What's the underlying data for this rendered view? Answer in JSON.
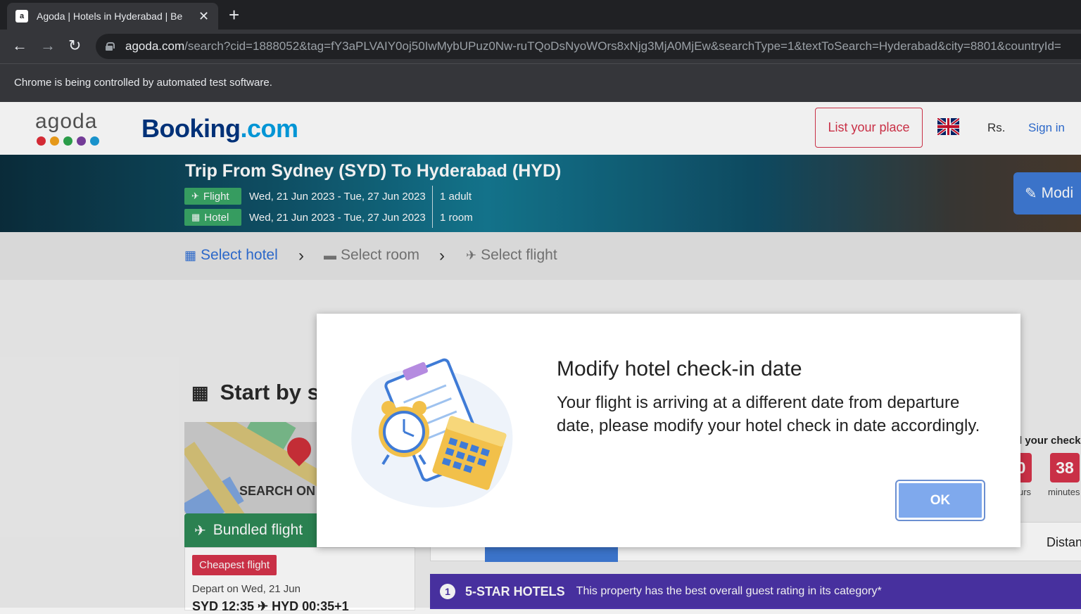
{
  "browser": {
    "tab_title": "Agoda | Hotels in Hyderabad | Be",
    "new_tab": "+",
    "url_host": "agoda.com",
    "url_path": "/search?cid=1888052&tag=fY3aPLVAIY0oj50IwMybUPuz0Nw-ruTQoDsNyoWOrs8xNjg3MjA0MjEw&searchType=1&textToSearch=Hyderabad&city=8801&countryId=",
    "infobar_text": "Chrome is being controlled by automated test software."
  },
  "header": {
    "agoda_logo_text": "agoda",
    "agoda_dot_colors": [
      "#e12d39",
      "#f4a21c",
      "#2da64e",
      "#7b3fa1",
      "#1b9cd8"
    ],
    "booking_logo_main": "Booking",
    "booking_logo_suffix": ".com",
    "list_your_place": "List your place",
    "currency": "Rs.",
    "sign_in": "Sign in"
  },
  "trip": {
    "title": "Trip From Sydney (SYD) To Hyderabad (HYD)",
    "flight_label": "Flight",
    "flight_dates": "Wed, 21 Jun 2023 - Tue, 27 Jun 2023",
    "flight_pax": "1 adult",
    "hotel_label": "Hotel",
    "hotel_dates": "Wed, 21 Jun 2023 - Tue, 27 Jun 2023",
    "hotel_rooms": "1 room",
    "modify_label": "Modi"
  },
  "steps": {
    "select_hotel": "Select hotel",
    "select_room": "Select room",
    "select_flight": "Select flight"
  },
  "content": {
    "start_by": "Start by s",
    "map_search": "SEARCH ON",
    "bundled_flight": "Bundled flight",
    "cheapest_flight": "Cheapest flight",
    "depart_on": "Depart on Wed, 21 Jun",
    "flight_times": "SYD 12:35 ✈ HYD 00:35+1",
    "timer_text": "l your check",
    "timer_hours_value": "0",
    "timer_hours_label": "urs",
    "timer_minutes_value": "38",
    "timer_minutes_label": "minutes",
    "distance_tab": "Distan",
    "five_star_badge": "1",
    "five_star_title": "5-STAR HOTELS",
    "five_star_desc": "This property has the best overall guest rating in its category*"
  },
  "modal": {
    "title": "Modify hotel check-in date",
    "body": "Your flight is arriving at a different date from departure date, please modify your hotel check in date accordingly.",
    "ok_label": "OK"
  }
}
